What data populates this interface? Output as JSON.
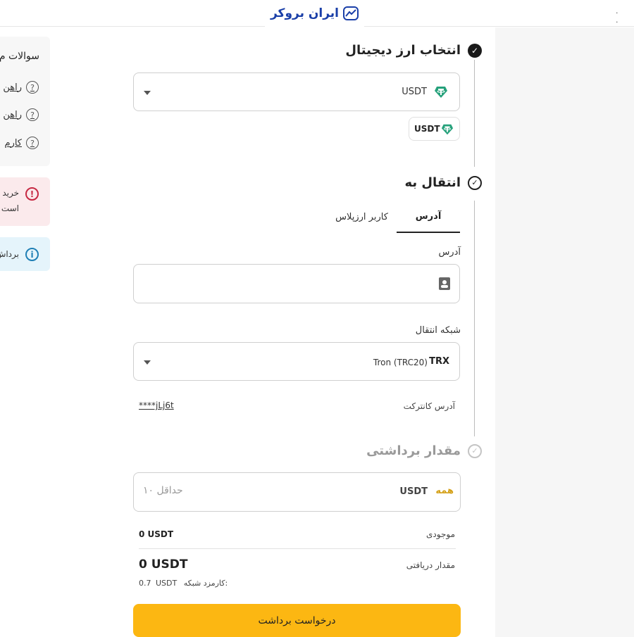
{
  "header": {
    "logo_text": "ایران بروکر",
    "menu_dots": "· ·"
  },
  "faq": {
    "title": "سوالات م",
    "items": [
      "راهن",
      "راهن",
      "کارم"
    ]
  },
  "alerts": {
    "red": {
      "line1": "خرید",
      "line2": "است"
    },
    "blue": {
      "text": "برداش"
    }
  },
  "step1": {
    "title": "انتخاب ارز دیجیتال",
    "selected_currency": "USDT",
    "chip_label": "USDT"
  },
  "step2": {
    "title": "انتقال به",
    "tabs": [
      {
        "label": "آدرس",
        "active": true
      },
      {
        "label": "کاربر ارزپلاس",
        "active": false
      }
    ],
    "address_label": "آدرس",
    "address_value": "",
    "network_label": "شبکه انتقال",
    "network_code": "TRX",
    "network_name": "Tron (TRC20)",
    "contract_label": "آدرس کانترکت",
    "contract_value": "****jLj6t"
  },
  "step3": {
    "title": "مقدار برداشتی",
    "amount_placeholder": "حداقل ۱۰",
    "unit": "USDT",
    "all_label": "همه",
    "balance_label": "موجودی",
    "balance_value": "0 USDT",
    "receive_label": "مقدار دریافتی",
    "receive_value": "0 USDT",
    "fee_label": "کارمزد شبکه:",
    "fee_unit": "USDT",
    "fee_value": "0.7"
  },
  "submit_label": "درخواست برداشت",
  "colors": {
    "accent": "#fcb712",
    "tether": "#26a17b",
    "logo": "#1a3fa8",
    "all_link": "#d4a017"
  }
}
